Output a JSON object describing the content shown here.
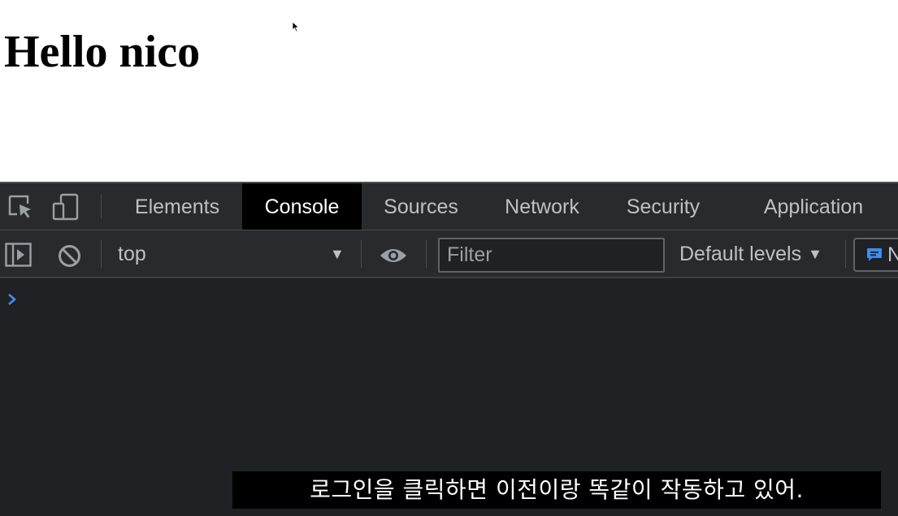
{
  "page": {
    "heading": "Hello nico"
  },
  "devtools": {
    "tabs": [
      {
        "label": "Elements",
        "active": false
      },
      {
        "label": "Console",
        "active": true
      },
      {
        "label": "Sources",
        "active": false
      },
      {
        "label": "Network",
        "active": false
      },
      {
        "label": "Security",
        "active": false
      },
      {
        "label": "Application",
        "active": false
      }
    ],
    "toolbar": {
      "context": "top",
      "filter_placeholder": "Filter",
      "levels_label": "Default levels",
      "issues_label": "N"
    },
    "icons": {
      "inspect": "inspect-element-icon",
      "device": "device-toolbar-icon",
      "sidebar": "sidebar-toggle-icon",
      "clear": "clear-console-icon",
      "eye": "live-expression-icon",
      "issues": "issues-message-icon",
      "prompt": "console-prompt-icon"
    },
    "colors": {
      "background": "#202124",
      "toolbar": "#292a2d",
      "active_tab": "#000000",
      "text": "#bdc1c6",
      "accent": "#3d8ef0"
    }
  },
  "subtitle": {
    "text": "로그인을 클릭하면 이전이랑 똑같이 작동하고 있어."
  }
}
